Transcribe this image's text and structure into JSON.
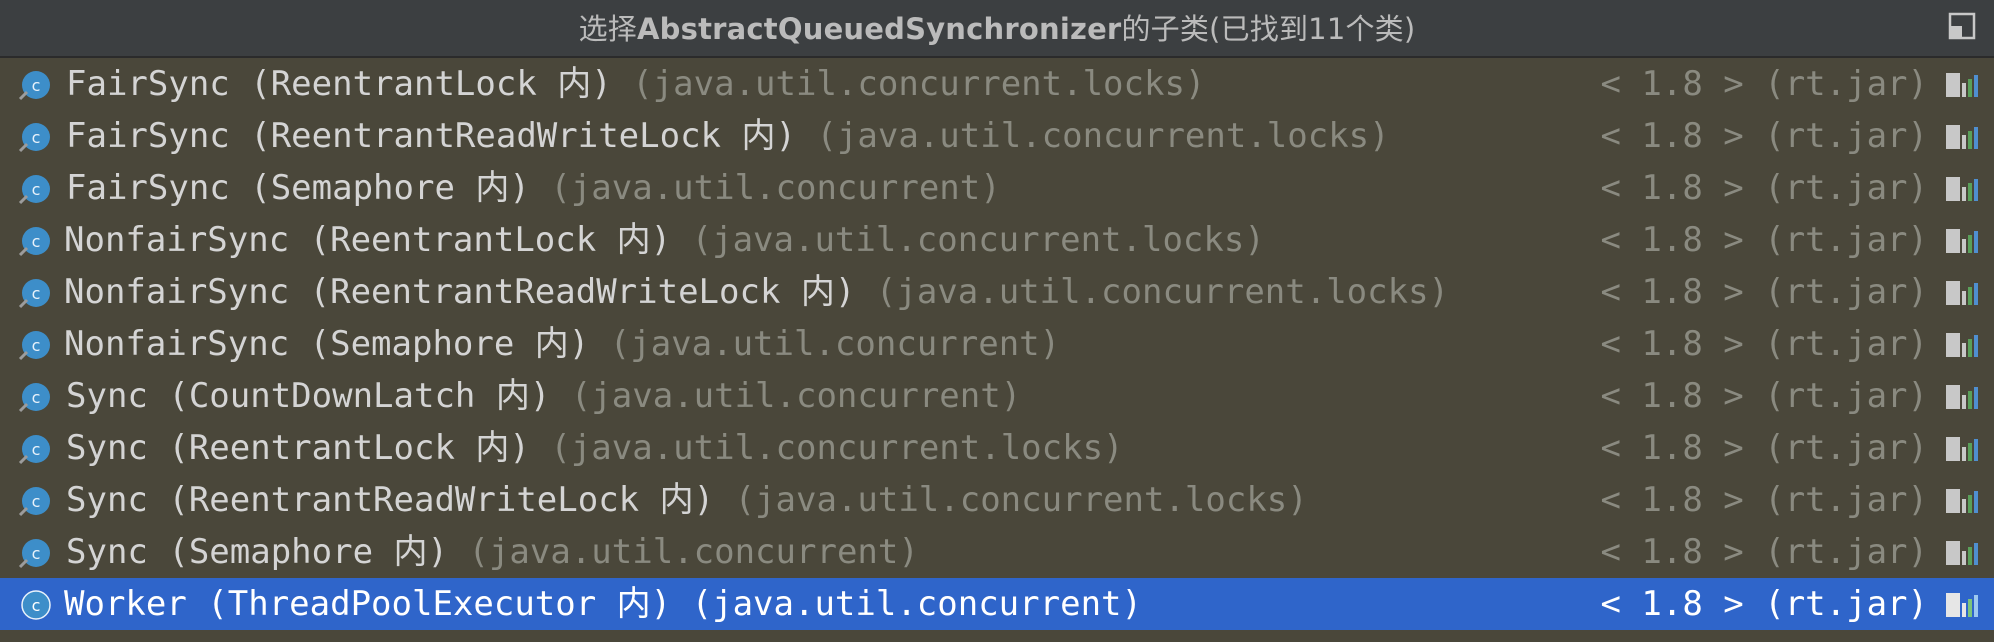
{
  "title": {
    "prefix": "选择",
    "class_name": "AbstractQueuedSynchronizer",
    "suffix": "的子类(已找到11个类)"
  },
  "colors": {
    "list_background": "#4a473a",
    "titlebar_background": "#3c3f41",
    "selection": "#2f65ca",
    "name_text": "#d4d4d4",
    "package_text": "#8a8a80",
    "class_icon": "#3d8ec9"
  },
  "icons": {
    "class": "class-icon",
    "library": "library-jar-icon",
    "pin": "pin-window-icon"
  },
  "results": [
    {
      "name": "FairSync (ReentrantLock 内)",
      "package": "(java.util.concurrent.locks)",
      "version": "< 1.8 > (rt.jar)",
      "selected": false
    },
    {
      "name": "FairSync (ReentrantReadWriteLock 内)",
      "package": "(java.util.concurrent.locks)",
      "version": "< 1.8 > (rt.jar)",
      "selected": false
    },
    {
      "name": "FairSync (Semaphore 内)",
      "package": "(java.util.concurrent)",
      "version": "< 1.8 > (rt.jar)",
      "selected": false
    },
    {
      "name": "NonfairSync (ReentrantLock 内)",
      "package": "(java.util.concurrent.locks)",
      "version": "< 1.8 > (rt.jar)",
      "selected": false
    },
    {
      "name": "NonfairSync (ReentrantReadWriteLock 内)",
      "package": "(java.util.concurrent.locks)",
      "version": "< 1.8 > (rt.jar)",
      "selected": false
    },
    {
      "name": "NonfairSync (Semaphore 内)",
      "package": "(java.util.concurrent)",
      "version": "< 1.8 > (rt.jar)",
      "selected": false
    },
    {
      "name": "Sync (CountDownLatch 内)",
      "package": "(java.util.concurrent)",
      "version": "< 1.8 > (rt.jar)",
      "selected": false
    },
    {
      "name": "Sync (ReentrantLock 内)",
      "package": "(java.util.concurrent.locks)",
      "version": "< 1.8 > (rt.jar)",
      "selected": false
    },
    {
      "name": "Sync (ReentrantReadWriteLock 内)",
      "package": "(java.util.concurrent.locks)",
      "version": "< 1.8 > (rt.jar)",
      "selected": false
    },
    {
      "name": "Sync (Semaphore 内)",
      "package": "(java.util.concurrent)",
      "version": "< 1.8 > (rt.jar)",
      "selected": false
    },
    {
      "name": "Worker (ThreadPoolExecutor 内)",
      "package": "(java.util.concurrent)",
      "version": "< 1.8 > (rt.jar)",
      "selected": true
    }
  ]
}
